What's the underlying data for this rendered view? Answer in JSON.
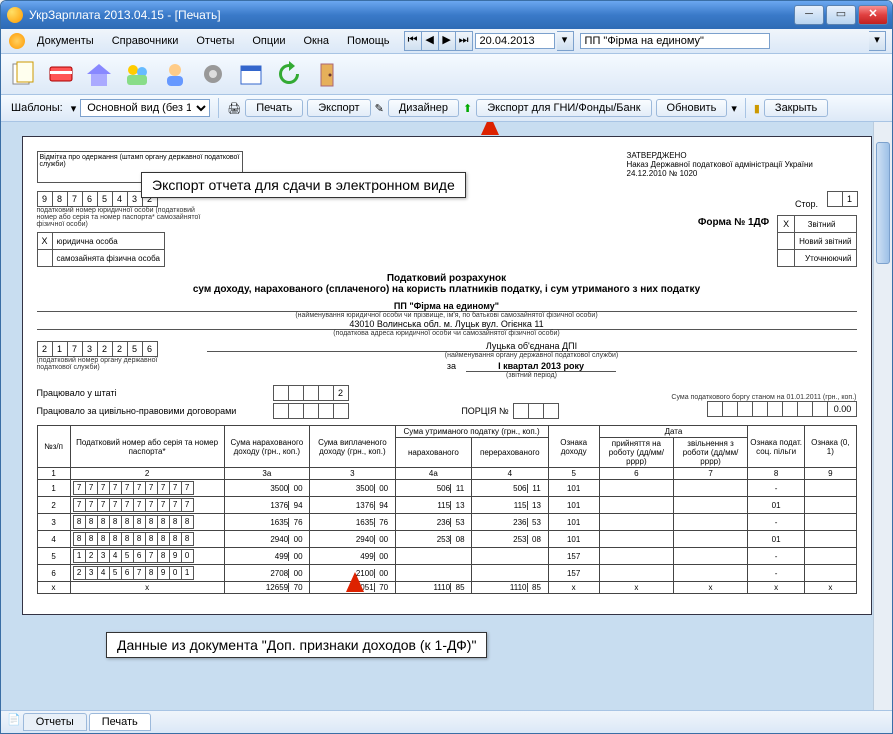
{
  "window": {
    "title": "УкрЗарплата 2013.04.15 - [Печать]"
  },
  "menu": {
    "documents": "Документы",
    "directories": "Справочники",
    "reports": "Отчеты",
    "options": "Опции",
    "windows": "Окна",
    "help": "Помощь",
    "date": "20.04.2013",
    "firm": "ПП \"Фірма на единому\""
  },
  "toolbar": {
    "templates_label": "Шаблоны:",
    "template_view": "Основной вид (без 133)",
    "print": "Печать",
    "export": "Экспорт",
    "designer": "Дизайнер",
    "export_tax": "Экспорт для ГНИ/Фонды/Банк",
    "refresh": "Обновить",
    "close": "Закрыть"
  },
  "callouts": {
    "export_tip": "Экспорт отчета для сдачи в электронном виде",
    "data_tip": "Данные из документа \"Доп. признаки доходов (к 1-ДФ)\""
  },
  "tabs": {
    "reports": "Отчеты",
    "print": "Печать"
  },
  "report": {
    "top_left_caption": "Відмітка про одержання (штамп органу державної податкової служби)",
    "approved": "ЗАТВЕРДЖЕНО",
    "approved_by": "Наказ Державної податкової адміністрації України",
    "approved_date": "24.12.2010  № 1020",
    "tax_id": [
      "9",
      "8",
      "7",
      "6",
      "5",
      "4",
      "3",
      "2"
    ],
    "tax_id_caption": "податковий номер юридичної особи (податковий номер або серія та номер паспорта* самозайнятої фізичної особи)",
    "form_no_label": "Форма № 1ДФ",
    "page_label": "Стор.",
    "page_value": "1",
    "report_types": {
      "zvitnyi_mark": "Х",
      "zvitnyi": "Звітний",
      "novyi": "Новий звітний",
      "utoch": "Уточнюючий"
    },
    "entity_types": {
      "legal_mark": "Х",
      "legal": "юридична особа",
      "self": "самозайнята фізична особа"
    },
    "title1": "Податковий розрахунок",
    "title2": "сум доходу, нарахованого (сплаченого) на користь платників податку, і сум утриманого з них податку",
    "firm_name": "ПП \"Фірма на единому\"",
    "firm_caption": "(найменування юридичної особи чи прізвище, ім'я, по батькові самозайнятої фізичної особи)",
    "address": "43010 Волинська обл. м. Луцьк вул. Огієнка 11",
    "address_caption": "(податкова адреса юридичної особи чи самозайнятої фізичної особи)",
    "authority_code": [
      "2",
      "1",
      "7",
      "3",
      "2",
      "2",
      "5",
      "6"
    ],
    "authority_code_caption": "(податковий номер органу державної податкової служби)",
    "authority_name": "Луцька об'єднана ДПІ",
    "authority_caption": "(найменування органу державної податкової служби)",
    "period_label": "за",
    "period": "I квартал 2013 року",
    "period_caption": "(звітний період)",
    "staff_label": "Працювало у штаті",
    "staff_value": "2",
    "civil_label": "Працювало за цивільно-правовими договорами",
    "portion_label": "ПОРЦІЯ №",
    "debt_label": "Сума податкового боргу станом на 01.01.2011 (грн., коп.)",
    "debt_value": "0.00",
    "headers": {
      "np": "№з/п",
      "tax_no": "Податковий номер або серія та номер паспорта*",
      "income_acc": "Сума нарахованого доходу (грн., коп.)",
      "income_paid": "Сума виплаченого доходу (грн., коп.)",
      "tax_withheld": "Сума утриманого податку (грн., коп.)",
      "tax_acc": "нарахованого",
      "tax_trans": "перерахованого",
      "income_sign": "Ознака доходу",
      "date": "Дата",
      "date_hire": "прийняття на роботу (дд/мм/рррр)",
      "date_fire": "звільнення з роботи (дд/мм/рррр)",
      "benefit": "Ознака подат. соц. пільги",
      "sign01": "Ознака (0, 1)",
      "c1": "1",
      "c2": "2",
      "c3a": "3а",
      "c3": "3",
      "c4a": "4а",
      "c4": "4",
      "c5": "5",
      "c6": "6",
      "c7": "7",
      "c8": "8",
      "c9": "9"
    },
    "rows": [
      {
        "n": "1",
        "id": "7777777777",
        "a3a": "3500",
        "a3ak": "00",
        "a3": "3500",
        "a3k": "00",
        "a4a": "506",
        "a4ak": "11",
        "a4": "506",
        "a4k": "11",
        "a5": "101",
        "benefit": "-"
      },
      {
        "n": "2",
        "id": "7777777777",
        "a3a": "1376",
        "a3ak": "94",
        "a3": "1376",
        "a3k": "94",
        "a4a": "115",
        "a4ak": "13",
        "a4": "115",
        "a4k": "13",
        "a5": "101",
        "benefit": "01"
      },
      {
        "n": "3",
        "id": "8888888888",
        "a3a": "1635",
        "a3ak": "76",
        "a3": "1635",
        "a3k": "76",
        "a4a": "236",
        "a4ak": "53",
        "a4": "236",
        "a4k": "53",
        "a5": "101",
        "benefit": "-"
      },
      {
        "n": "4",
        "id": "8888888888",
        "a3a": "2940",
        "a3ak": "00",
        "a3": "2940",
        "a3k": "00",
        "a4a": "253",
        "a4ak": "08",
        "a4": "253",
        "a4k": "08",
        "a5": "101",
        "benefit": "01"
      },
      {
        "n": "5",
        "id": "1234567890",
        "a3a": "499",
        "a3ak": "00",
        "a3": "499",
        "a3k": "00",
        "a4a": "",
        "a4ak": "",
        "a4": "",
        "a4k": "",
        "a5": "157",
        "benefit": "-"
      },
      {
        "n": "6",
        "id": "2345678901",
        "a3a": "2708",
        "a3ak": "00",
        "a3": "2100",
        "a3k": "00",
        "a4a": "",
        "a4ak": "",
        "a4": "",
        "a4k": "",
        "a5": "157",
        "benefit": "-"
      }
    ],
    "totals": {
      "label": "х",
      "id": "х",
      "a3a": "12659",
      "a3ak": "70",
      "a3": "12051",
      "a3k": "70",
      "a4a": "1110",
      "a4ak": "85",
      "a4": "1110",
      "a4k": "85",
      "a5": "х",
      "benefit": "х",
      "sign": "х"
    }
  }
}
